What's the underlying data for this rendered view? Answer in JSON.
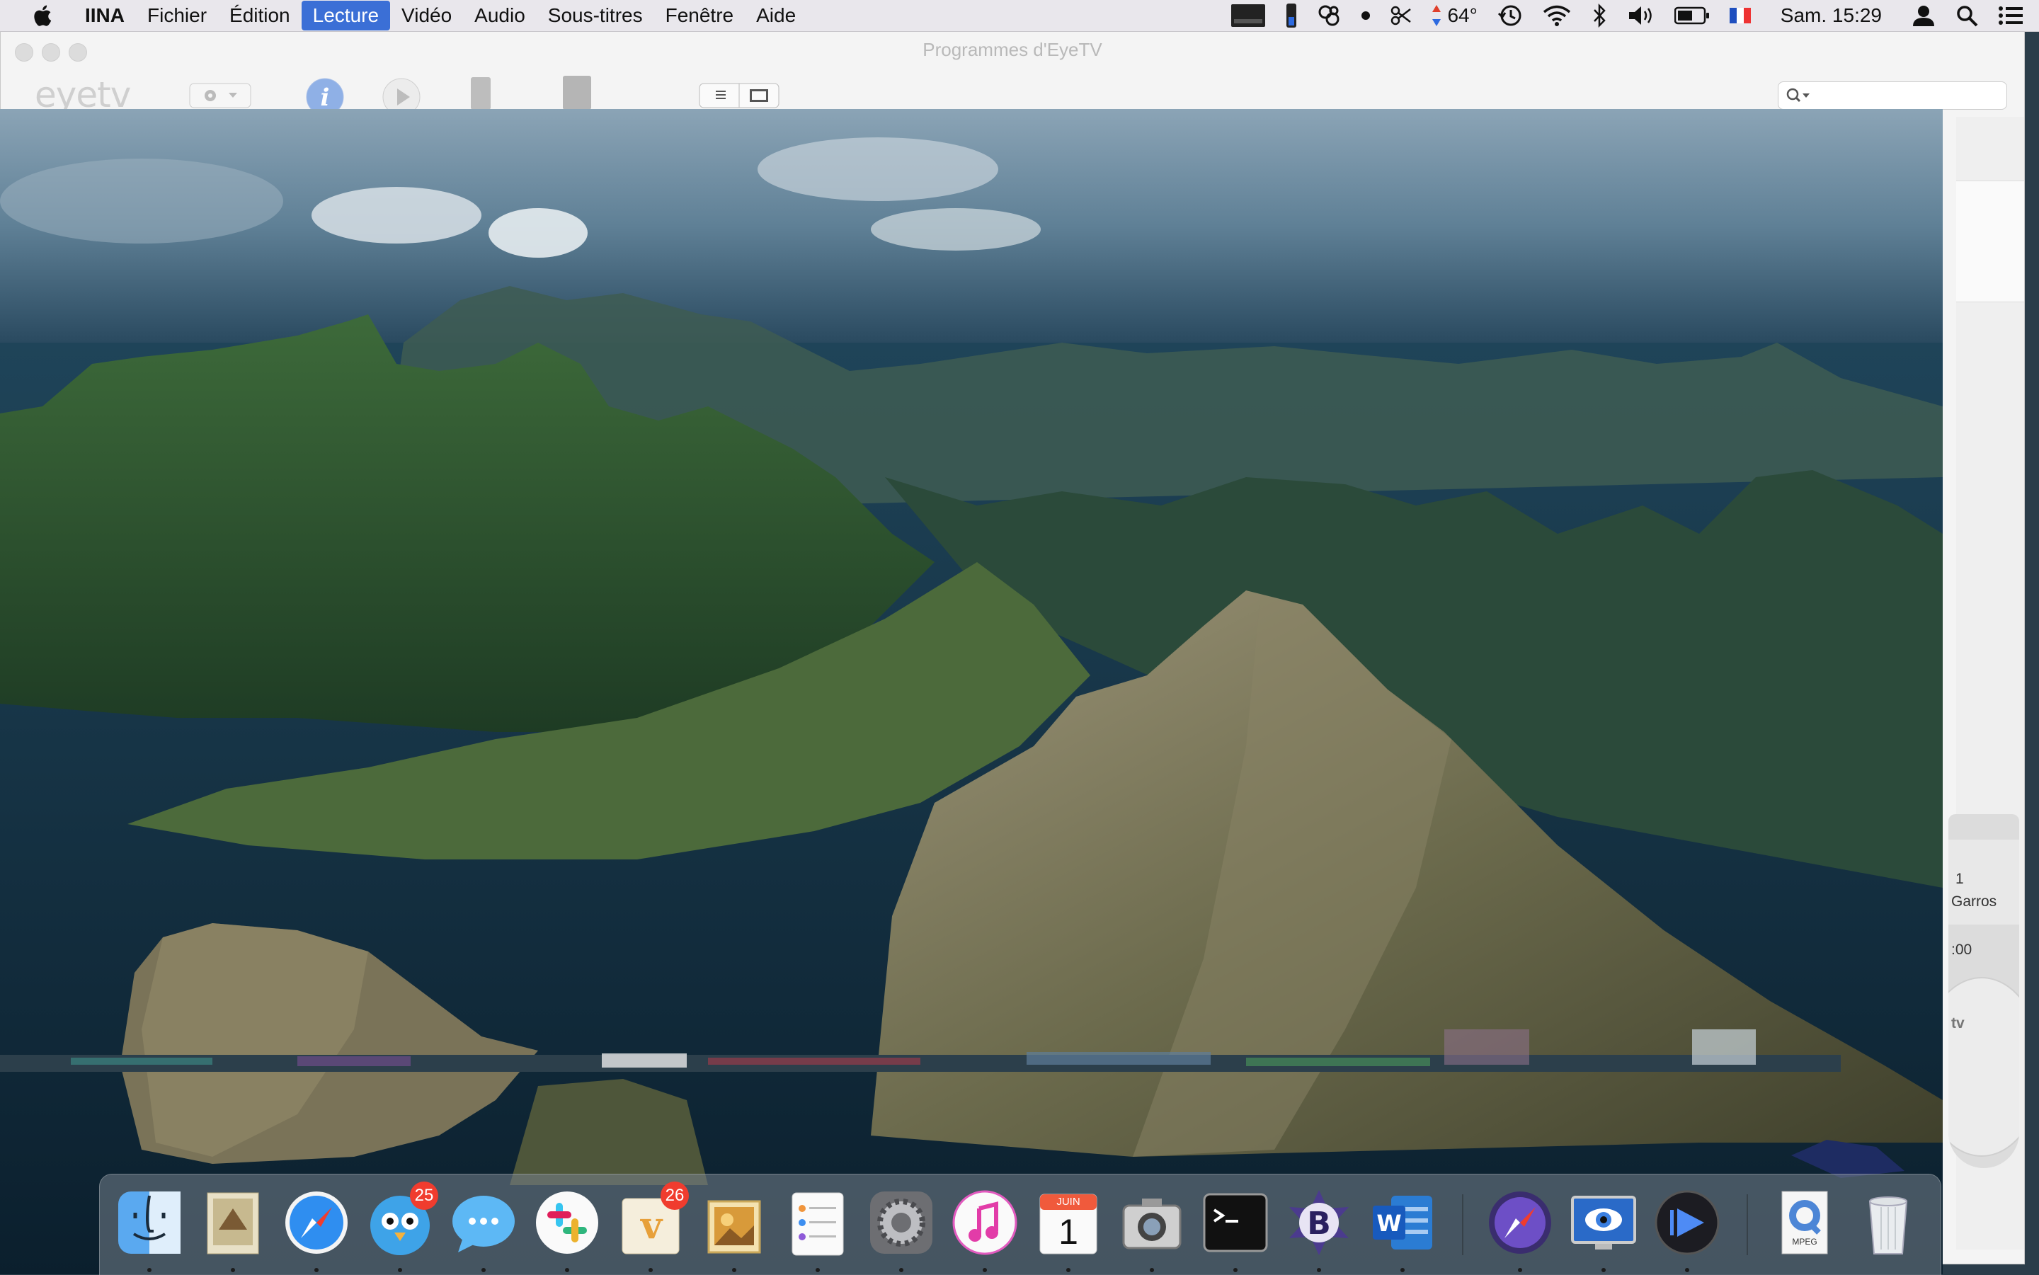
{
  "menubar": {
    "app_name": "IINA",
    "items": [
      "Fichier",
      "Édition",
      "Lecture",
      "Vidéo",
      "Audio",
      "Sous-titres",
      "Fenêtre",
      "Aide"
    ],
    "active_item": "Lecture",
    "temperature": "64°",
    "clock": "Sam. 15:29",
    "icons": [
      "display-icon",
      "battery-widget-icon",
      "mesh-icon",
      "dot-icon",
      "scissors-icon",
      "temperature-icon",
      "time-machine-icon",
      "wifi-icon",
      "bluetooth-icon",
      "volume-icon",
      "battery-icon",
      "french-flag-icon",
      "user-icon",
      "spotlight-icon",
      "notification-center-icon"
    ]
  },
  "eyetv_window": {
    "title": "Programmes d'EyeTV",
    "logo": "eyetv",
    "remote": {
      "channel": "1",
      "program": "Garros",
      "time": ":00",
      "brand": "tv"
    }
  },
  "video": {
    "description_color_sky": "#5c7c92",
    "description_color_sea": "#123042"
  },
  "dock": {
    "apps": [
      {
        "name": "Finder",
        "icon": "finder-icon",
        "running": true
      },
      {
        "name": "Mail",
        "icon": "mail-icon",
        "running": true
      },
      {
        "name": "Safari",
        "icon": "safari-icon",
        "running": true
      },
      {
        "name": "Tweetbot",
        "icon": "tweetbot-icon",
        "running": true,
        "badge": "25"
      },
      {
        "name": "Messages",
        "icon": "messages-icon",
        "running": true
      },
      {
        "name": "Slack",
        "icon": "slack-icon",
        "running": true
      },
      {
        "name": "Vienna",
        "icon": "rss-icon",
        "running": true,
        "badge": "26"
      },
      {
        "name": "Preview",
        "icon": "preview-icon",
        "running": true
      },
      {
        "name": "Reminders",
        "icon": "reminders-icon",
        "running": true
      },
      {
        "name": "System Preferences",
        "icon": "gear-icon",
        "running": true
      },
      {
        "name": "iTunes",
        "icon": "itunes-icon",
        "running": true
      },
      {
        "name": "Calendar",
        "icon": "calendar-icon",
        "running": true,
        "month": "JUIN",
        "day": "1"
      },
      {
        "name": "Screenshot",
        "icon": "screenshot-icon",
        "running": true
      },
      {
        "name": "Terminal",
        "icon": "terminal-icon",
        "running": true
      },
      {
        "name": "BBEdit",
        "icon": "bbedit-icon",
        "running": true
      },
      {
        "name": "Word",
        "icon": "word-icon",
        "running": true
      },
      {
        "name": "Safari Technology Preview",
        "icon": "safari-tp-icon",
        "running": true
      },
      {
        "name": "EyeTV",
        "icon": "eyetv-icon",
        "running": true
      },
      {
        "name": "IINA",
        "icon": "iina-icon",
        "running": true
      },
      {
        "name": "MPEG Streamclip",
        "icon": "mpeg-icon",
        "running": false,
        "label": "MPEG"
      },
      {
        "name": "Trash",
        "icon": "trash-icon",
        "running": false
      }
    ]
  }
}
